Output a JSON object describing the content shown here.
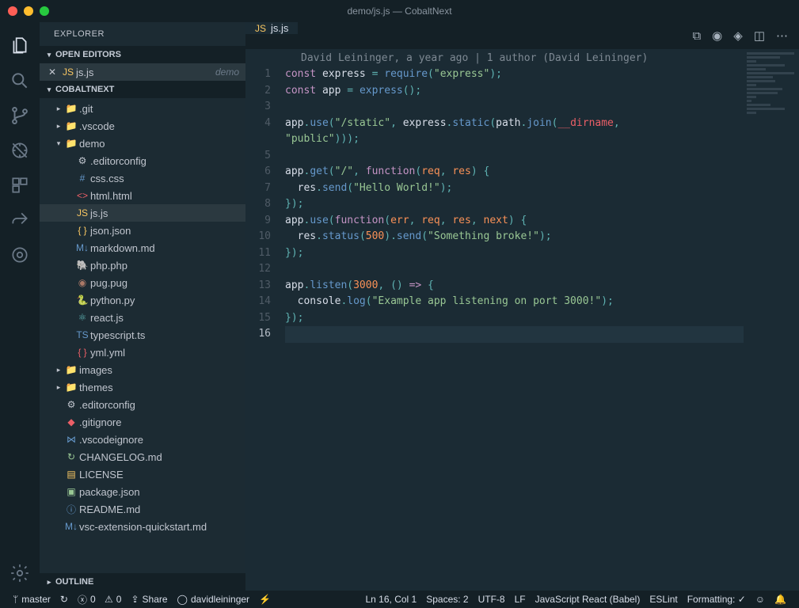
{
  "window": {
    "title": "demo/js.js — CobaltNext"
  },
  "sidebar": {
    "title": "EXPLORER",
    "open_editors_label": "OPEN EDITORS",
    "open_editors": [
      {
        "name": "js.js",
        "hint": "demo",
        "icon": "js"
      }
    ],
    "project_label": "COBALTNEXT",
    "outline_label": "OUTLINE",
    "tree": [
      {
        "depth": 1,
        "kind": "folder",
        "name": ".git",
        "expanded": false,
        "icon": "folder-git"
      },
      {
        "depth": 1,
        "kind": "folder",
        "name": ".vscode",
        "expanded": false,
        "icon": "folder"
      },
      {
        "depth": 1,
        "kind": "folder",
        "name": "demo",
        "expanded": true,
        "icon": "folder"
      },
      {
        "depth": 2,
        "kind": "file",
        "name": ".editorconfig",
        "icon": "gear"
      },
      {
        "depth": 2,
        "kind": "file",
        "name": "css.css",
        "icon": "css"
      },
      {
        "depth": 2,
        "kind": "file",
        "name": "html.html",
        "icon": "html"
      },
      {
        "depth": 2,
        "kind": "file",
        "name": "js.js",
        "icon": "js",
        "selected": true
      },
      {
        "depth": 2,
        "kind": "file",
        "name": "json.json",
        "icon": "json"
      },
      {
        "depth": 2,
        "kind": "file",
        "name": "markdown.md",
        "icon": "md"
      },
      {
        "depth": 2,
        "kind": "file",
        "name": "php.php",
        "icon": "php"
      },
      {
        "depth": 2,
        "kind": "file",
        "name": "pug.pug",
        "icon": "pug"
      },
      {
        "depth": 2,
        "kind": "file",
        "name": "python.py",
        "icon": "py"
      },
      {
        "depth": 2,
        "kind": "file",
        "name": "react.js",
        "icon": "react"
      },
      {
        "depth": 2,
        "kind": "file",
        "name": "typescript.ts",
        "icon": "ts"
      },
      {
        "depth": 2,
        "kind": "file",
        "name": "yml.yml",
        "icon": "yml"
      },
      {
        "depth": 1,
        "kind": "folder",
        "name": "images",
        "expanded": false,
        "icon": "folder-img"
      },
      {
        "depth": 1,
        "kind": "folder",
        "name": "themes",
        "expanded": false,
        "icon": "folder-theme"
      },
      {
        "depth": 1,
        "kind": "file",
        "name": ".editorconfig",
        "icon": "gear"
      },
      {
        "depth": 1,
        "kind": "file",
        "name": ".gitignore",
        "icon": "git"
      },
      {
        "depth": 1,
        "kind": "file",
        "name": ".vscodeignore",
        "icon": "vscode"
      },
      {
        "depth": 1,
        "kind": "file",
        "name": "CHANGELOG.md",
        "icon": "changelog"
      },
      {
        "depth": 1,
        "kind": "file",
        "name": "LICENSE",
        "icon": "license"
      },
      {
        "depth": 1,
        "kind": "file",
        "name": "package.json",
        "icon": "npm"
      },
      {
        "depth": 1,
        "kind": "file",
        "name": "README.md",
        "icon": "info"
      },
      {
        "depth": 1,
        "kind": "file",
        "name": "vsc-extension-quickstart.md",
        "icon": "md"
      }
    ]
  },
  "tabs": [
    {
      "name": "js.js",
      "icon": "js"
    }
  ],
  "blame": "David Leininger, a year ago | 1 author (David Leininger)",
  "code": {
    "lines": [
      {
        "n": 1,
        "html": "<span class='tok-kw'>const</span> <span class='tok-var'>express</span> <span class='tok-eq'>=</span> <span class='tok-fn'>require</span><span class='tok-punc'>(</span><span class='tok-str'>\"express\"</span><span class='tok-punc'>);</span>"
      },
      {
        "n": 2,
        "html": "<span class='tok-kw'>const</span> <span class='tok-var'>app</span> <span class='tok-eq'>=</span> <span class='tok-fn'>express</span><span class='tok-punc'>();</span>"
      },
      {
        "n": 3,
        "html": ""
      },
      {
        "n": 4,
        "html": "<span class='tok-var'>app</span><span class='tok-punc'>.</span><span class='tok-prop'>use</span><span class='tok-punc'>(</span><span class='tok-str'>\"/static\"</span><span class='tok-punc'>,</span> <span class='tok-var'>express</span><span class='tok-punc'>.</span><span class='tok-fn'>static</span><span class='tok-punc'>(</span><span class='tok-var'>path</span><span class='tok-punc'>.</span><span class='tok-fn'>join</span><span class='tok-punc'>(</span><span class='tok-const'>__dirname</span><span class='tok-punc'>,</span>"
      },
      {
        "n": 0,
        "cont": true,
        "html": "<span class='tok-str'>\"public\"</span><span class='tok-punc'>)));</span>"
      },
      {
        "n": 5,
        "html": ""
      },
      {
        "n": 6,
        "html": "<span class='tok-var'>app</span><span class='tok-punc'>.</span><span class='tok-prop'>get</span><span class='tok-punc'>(</span><span class='tok-str'>\"/\"</span><span class='tok-punc'>,</span> <span class='tok-kw'>function</span><span class='tok-punc'>(</span><span class='tok-param'>req</span><span class='tok-punc'>,</span> <span class='tok-param'>res</span><span class='tok-punc'>) {</span>"
      },
      {
        "n": 7,
        "html": "  <span class='tok-var'>res</span><span class='tok-punc'>.</span><span class='tok-fn'>send</span><span class='tok-punc'>(</span><span class='tok-str'>\"Hello World!\"</span><span class='tok-punc'>);</span>"
      },
      {
        "n": 8,
        "html": "<span class='tok-punc'>});</span>"
      },
      {
        "n": 9,
        "html": "<span class='tok-var'>app</span><span class='tok-punc'>.</span><span class='tok-prop'>use</span><span class='tok-punc'>(</span><span class='tok-kw'>function</span><span class='tok-punc'>(</span><span class='tok-param'>err</span><span class='tok-punc'>,</span> <span class='tok-param'>req</span><span class='tok-punc'>,</span> <span class='tok-param'>res</span><span class='tok-punc'>,</span> <span class='tok-param'>next</span><span class='tok-punc'>) {</span>"
      },
      {
        "n": 10,
        "html": "  <span class='tok-var'>res</span><span class='tok-punc'>.</span><span class='tok-fn'>status</span><span class='tok-punc'>(</span><span class='tok-num'>500</span><span class='tok-punc'>).</span><span class='tok-fn'>send</span><span class='tok-punc'>(</span><span class='tok-str'>\"Something broke!\"</span><span class='tok-punc'>);</span>"
      },
      {
        "n": 11,
        "html": "<span class='tok-punc'>});</span>"
      },
      {
        "n": 12,
        "html": ""
      },
      {
        "n": 13,
        "html": "<span class='tok-var'>app</span><span class='tok-punc'>.</span><span class='tok-prop'>listen</span><span class='tok-punc'>(</span><span class='tok-num'>3000</span><span class='tok-punc'>,</span> <span class='tok-punc'>()</span> <span class='tok-kw'>=></span> <span class='tok-punc'>{</span>"
      },
      {
        "n": 14,
        "html": "  <span class='tok-var'>console</span><span class='tok-punc'>.</span><span class='tok-fn'>log</span><span class='tok-punc'>(</span><span class='tok-str'>\"Example app listening on port 3000!\"</span><span class='tok-punc'>);</span>"
      },
      {
        "n": 15,
        "html": "<span class='tok-punc'>});</span>"
      },
      {
        "n": 16,
        "html": "",
        "current": true
      }
    ]
  },
  "status": {
    "branch": "master",
    "errors": "0",
    "warnings": "0",
    "share": "Share",
    "ghuser": "davidleininger",
    "cursor": "Ln 16, Col 1",
    "spaces": "Spaces: 2",
    "encoding": "UTF-8",
    "eol": "LF",
    "language": "JavaScript React (Babel)",
    "linter": "ESLint",
    "formatting": "Formatting: ✓"
  },
  "icons": {
    "folder": "📁",
    "folder-git": "📁",
    "folder-img": "📁",
    "folder-theme": "📁",
    "js": "JS",
    "css": "#",
    "html": "<>",
    "json": "{ }",
    "md": "M↓",
    "php": "🐘",
    "pug": "◉",
    "py": "🐍",
    "react": "⚛",
    "ts": "TS",
    "yml": "{ }",
    "gear": "⚙",
    "git": "◆",
    "vscode": "⋈",
    "changelog": "↻",
    "license": "▤",
    "npm": "▣",
    "info": "ⓘ"
  }
}
